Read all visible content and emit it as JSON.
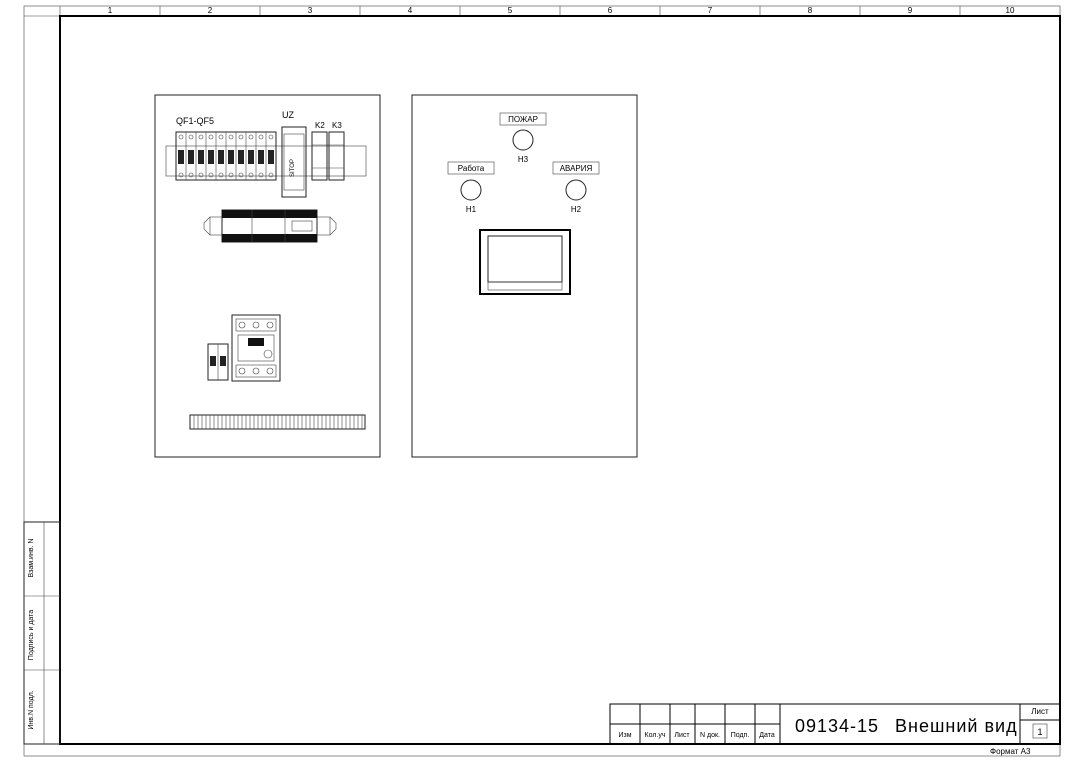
{
  "frame": {
    "ruler_cols": [
      "1",
      "2",
      "3",
      "4",
      "5",
      "6",
      "7",
      "8",
      "9",
      "10"
    ],
    "format_label": "Формат А3"
  },
  "titleblock": {
    "doc_number": "09134-15",
    "doc_title": "Внешний вид",
    "sheet_label": "Лист",
    "sheet_number": "1",
    "headers": [
      "Изм",
      "Кол.уч",
      "Лист",
      "N док.",
      "Подп.",
      "Дата"
    ]
  },
  "sidebar": {
    "cells": [
      "Инв.N подл.",
      "Подпись и дата",
      "Взам.инв. N"
    ]
  },
  "panel_internal": {
    "label_breakers": "QF1-QF5",
    "label_uz": "UZ",
    "label_uz_sub": "SITOP",
    "label_k2": "K2",
    "label_k3": "K3"
  },
  "panel_door": {
    "fire_box": "ПОЖАР",
    "work_box": "Работа",
    "alarm_box": "АВАРИЯ",
    "h1": "H1",
    "h2": "H2",
    "h3": "H3"
  }
}
